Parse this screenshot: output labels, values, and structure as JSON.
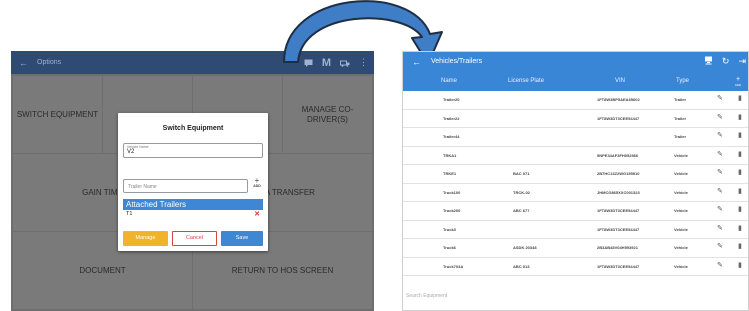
{
  "left": {
    "topbar": {
      "back_icon": "←",
      "title": "Options"
    },
    "tiles": {
      "switch_equipment": "SWITCH EQUIPMENT",
      "manage_co_drivers": "MANAGE CO-DRIVER(S)",
      "gain_time": "GAIN TIME",
      "data_transfer": "DATA TRANSFER",
      "document": "DOCUMENT",
      "return_to_hos": "RETURN TO HOS SCREEN"
    },
    "dialog": {
      "title": "Switch Equipment",
      "vehicle_label": "Vehicle Name",
      "vehicle_value": "V2",
      "trailer_placeholder": "Trailer Name",
      "add_label": "ADD",
      "attached_header": "Attached Trailers",
      "attached": [
        "T1"
      ],
      "manage_label": "Manage",
      "cancel_label": "Cancel",
      "save_label": "Save"
    }
  },
  "right": {
    "topbar": {
      "back_icon": "←",
      "title": "Vehicles/Trailers"
    },
    "columns": {
      "name": "Name",
      "plate": "License Plate",
      "vin": "VIN",
      "type": "Type",
      "add": "ADD"
    },
    "rows": [
      {
        "name": "Trailer20",
        "plate": "",
        "vin": "1FT8W3BP5AEA65602",
        "type": "Trailer"
      },
      {
        "name": "Trailer22",
        "plate": "",
        "vin": "1FT8W3DT3CEE54447",
        "type": "Trailer"
      },
      {
        "name": "Trailer44",
        "plate": "",
        "vin": "",
        "type": "Trailer"
      },
      {
        "name": "TRKA1",
        "plate": "",
        "vin": "5NPE34AF3FH052566",
        "type": "Vehicle"
      },
      {
        "name": "TRKE1",
        "plate": "BAC 071",
        "vin": "2B7HC13Z2WG155910",
        "type": "Vehicle"
      },
      {
        "name": "Truck100",
        "plate": "TRCK-02",
        "vin": "JHMCG865XXC001323",
        "type": "Vehicle"
      },
      {
        "name": "Truck200",
        "plate": "ABC 677",
        "vin": "1FT8W3DT3CEE54447",
        "type": "Vehicle"
      },
      {
        "name": "Truck3",
        "plate": "",
        "vin": "1FT8W3DT3CEE54447",
        "type": "Vehicle"
      },
      {
        "name": "Truck6",
        "plate": "ASDK 20348",
        "vin": "2B3AB48V04H593921",
        "type": "Vehicle"
      },
      {
        "name": "Truck703A",
        "plate": "ABC 013",
        "vin": "1FT8W3DT3CEE54447",
        "type": "Vehicle"
      }
    ],
    "search_placeholder": "Search Equipment"
  }
}
